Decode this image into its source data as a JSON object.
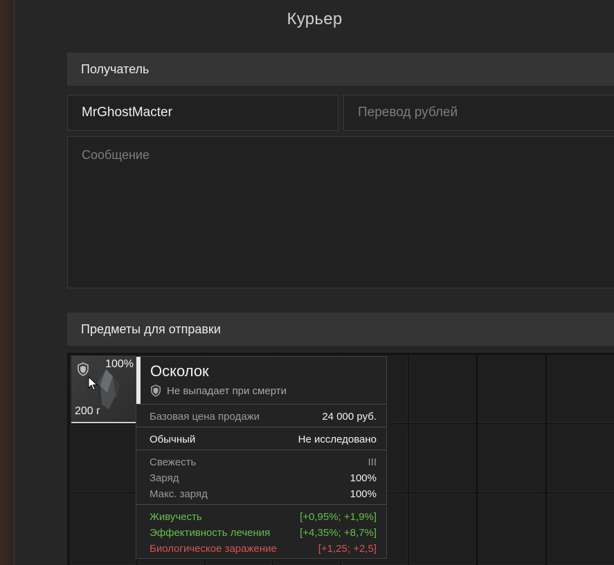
{
  "window": {
    "title": "Курьер"
  },
  "recipient": {
    "section_label": "Получатель",
    "name_value": "MrGhostMacter",
    "rubles_placeholder": "Перевод рублей",
    "message_placeholder": "Сообщение"
  },
  "items": {
    "section_label": "Предметы для отправки",
    "slot": {
      "durability": "100%",
      "weight": "200 г",
      "icons": [
        "shield-icon",
        "crystal-shard-icon"
      ]
    }
  },
  "tooltip": {
    "name": "Осколок",
    "subtitle": "Не выпадает при смерти",
    "price_label": "Базовая цена продажи",
    "price_value": "24 000 руб.",
    "rarity": "Обычный",
    "research": "Не исследовано",
    "freshness_label": "Свежесть",
    "freshness_value": "III",
    "charge_label": "Заряд",
    "charge_value": "100%",
    "max_charge_label": "Макс. заряд",
    "max_charge_value": "100%",
    "stats": [
      {
        "label": "Живучесть",
        "value": "[+0,95%; +1,9%]",
        "color": "#64c04b"
      },
      {
        "label": "Эффективность лечения",
        "value": "[+4,35%; +8,7%]",
        "color": "#64c04b"
      },
      {
        "label": "Биологическое заражение",
        "value": "[+1,25; +2,5]",
        "color": "#d65454"
      }
    ]
  }
}
